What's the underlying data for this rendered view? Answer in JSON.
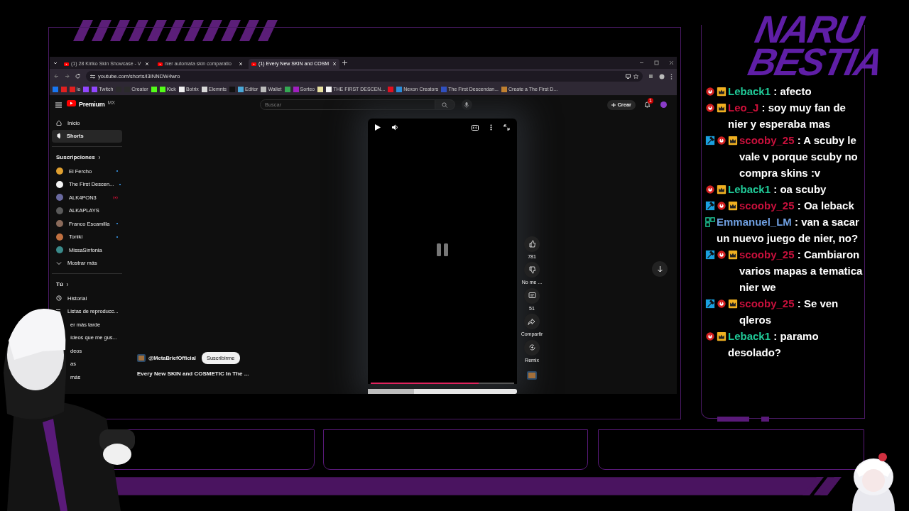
{
  "overlay": {
    "logo": [
      "NARU",
      "BESTIA"
    ]
  },
  "browser": {
    "tabs": [
      {
        "title": "(1) 28 Kiriko Skin Showcase - V",
        "selected": false
      },
      {
        "title": "nier automata skin comparatio",
        "selected": false
      },
      {
        "title": "(1) Every New SKIN and COSM",
        "selected": true
      }
    ],
    "address": "youtube.com/shorts/I3INNDW4wro",
    "bookmarks": [
      {
        "color": "#1877f2"
      },
      {
        "color": "#e02020"
      },
      {
        "color": "#e02020",
        "label": "io"
      },
      {
        "color": "#9146ff"
      },
      {
        "color": "#9146ff",
        "label": "Twitch"
      },
      {
        "color": "#2b2b2b"
      },
      {
        "color": "#2b2b2b",
        "label": "Creator"
      },
      {
        "color": "#53fc18"
      },
      {
        "color": "#53fc18",
        "label": "Kick"
      },
      {
        "color": "#f0f0f0",
        "label": "Botrix"
      },
      {
        "color": "#d8d8d8",
        "label": "Elemnts"
      },
      {
        "color": "#111111"
      },
      {
        "color": "#4aa8d8",
        "label": "Editor"
      },
      {
        "color": "#bbbbbb",
        "label": "Wallet"
      },
      {
        "color": "#34a853"
      },
      {
        "color": "#a020c0",
        "label": "Sorteo"
      },
      {
        "color": "#e8e0a0"
      },
      {
        "color": "#f5f5f5",
        "label": "THE FIRST DESCEN..."
      },
      {
        "color": "#e01020"
      },
      {
        "color": "#2a8cd8",
        "label": "Nexon Creators"
      },
      {
        "color": "#3050c0",
        "label": "The First Descendan..."
      },
      {
        "color": "#c08030",
        "label": "Create a The First D..."
      }
    ]
  },
  "youtube": {
    "brand": "Premium",
    "region": "MX",
    "search": {
      "placeholder": "Buscar"
    },
    "create": "Crear",
    "notifications": "1",
    "nav": [
      {
        "label": "Inicio",
        "selected": false
      },
      {
        "label": "Shorts",
        "selected": true
      }
    ],
    "subscriptions_heading": "Suscripciones",
    "subscriptions": [
      {
        "name": "El Fercho",
        "new_content": true,
        "live": false,
        "color": "#e0a030"
      },
      {
        "name": "The First Descen...",
        "new_content": true,
        "live": false,
        "color": "#f5f5f5"
      },
      {
        "name": "ALK4PON3",
        "new_content": false,
        "live": true,
        "color": "#6a6aa0"
      },
      {
        "name": "ALKAPLAYS",
        "new_content": false,
        "live": false,
        "color": "#5a5a5a"
      },
      {
        "name": "Franco Escamilla",
        "new_content": true,
        "live": false,
        "color": "#8a6a5a"
      },
      {
        "name": "Toniki",
        "new_content": true,
        "live": false,
        "color": "#c07040"
      },
      {
        "name": "MissaSinfonia",
        "new_content": false,
        "live": false,
        "color": "#3a8a8a"
      }
    ],
    "show_more": "Mostrar más",
    "you_heading": "Tú",
    "you_items": [
      {
        "label": "Historial",
        "kind": "full"
      },
      {
        "label": "Listas de reproducc...",
        "kind": "full"
      },
      {
        "label": "er más tarde",
        "kind": "covered"
      },
      {
        "label": "ídeos que me gus...",
        "kind": "covered"
      },
      {
        "label": "deos",
        "kind": "covered"
      },
      {
        "label": "as",
        "kind": "covered"
      },
      {
        "label": "más",
        "kind": "covered"
      }
    ],
    "short": {
      "channel": "@MetaBriefOfficial",
      "subscribe": "Suscribirme",
      "title": "Every New SKIN and COSMETIC In The ...",
      "level": 0.75,
      "actions": [
        {
          "kind": "like",
          "label": "781"
        },
        {
          "kind": "dislike",
          "label": "No me ..."
        },
        {
          "kind": "comment",
          "label": "51"
        },
        {
          "kind": "share",
          "label": "Compartir"
        },
        {
          "kind": "remix",
          "label": "Remix"
        }
      ]
    }
  },
  "chat": [
    {
      "name": "Leback1",
      "color": "#20c997",
      "badges": [
        {
          "kind": "ring"
        },
        {
          "kind": "crown"
        }
      ],
      "text": ": afecto"
    },
    {
      "name": "Leo_J",
      "color": "#d0103a",
      "badges": [
        {
          "kind": "ring"
        },
        {
          "kind": "crown"
        }
      ],
      "text": ": soy muy fan de nier y esperaba mas"
    },
    {
      "name": "scooby_25",
      "color": "#c8103c",
      "badges": [
        {
          "kind": "hammer"
        },
        {
          "kind": "ring"
        },
        {
          "kind": "crown"
        }
      ],
      "text": ": A scuby le vale v porque scuby no compra skins :v"
    },
    {
      "name": "Leback1",
      "color": "#20c997",
      "badges": [
        {
          "kind": "ring"
        },
        {
          "kind": "crown"
        }
      ],
      "text": ": oa scuby"
    },
    {
      "name": "scooby_25",
      "color": "#c8103c",
      "badges": [
        {
          "kind": "hammer"
        },
        {
          "kind": "ring"
        },
        {
          "kind": "crown"
        }
      ],
      "text": ": Oa leback"
    },
    {
      "name": "Emmanuel_LM",
      "color": "#6f9fe0",
      "badges": [
        {
          "kind": "grid"
        }
      ],
      "text": ": van a sacar un nuevo juego de nier, no?"
    },
    {
      "name": "scooby_25",
      "color": "#c8103c",
      "badges": [
        {
          "kind": "hammer"
        },
        {
          "kind": "ring"
        },
        {
          "kind": "crown"
        }
      ],
      "text": ": Cambiaron varios mapas a tematica nier we"
    },
    {
      "name": "scooby_25",
      "color": "#c8103c",
      "badges": [
        {
          "kind": "hammer"
        },
        {
          "kind": "ring"
        },
        {
          "kind": "crown"
        }
      ],
      "text": ": Se ven qleros"
    },
    {
      "name": "Leback1",
      "color": "#20c997",
      "badges": [
        {
          "kind": "ring"
        },
        {
          "kind": "crown"
        }
      ],
      "text": ": paramo desolado?"
    }
  ]
}
